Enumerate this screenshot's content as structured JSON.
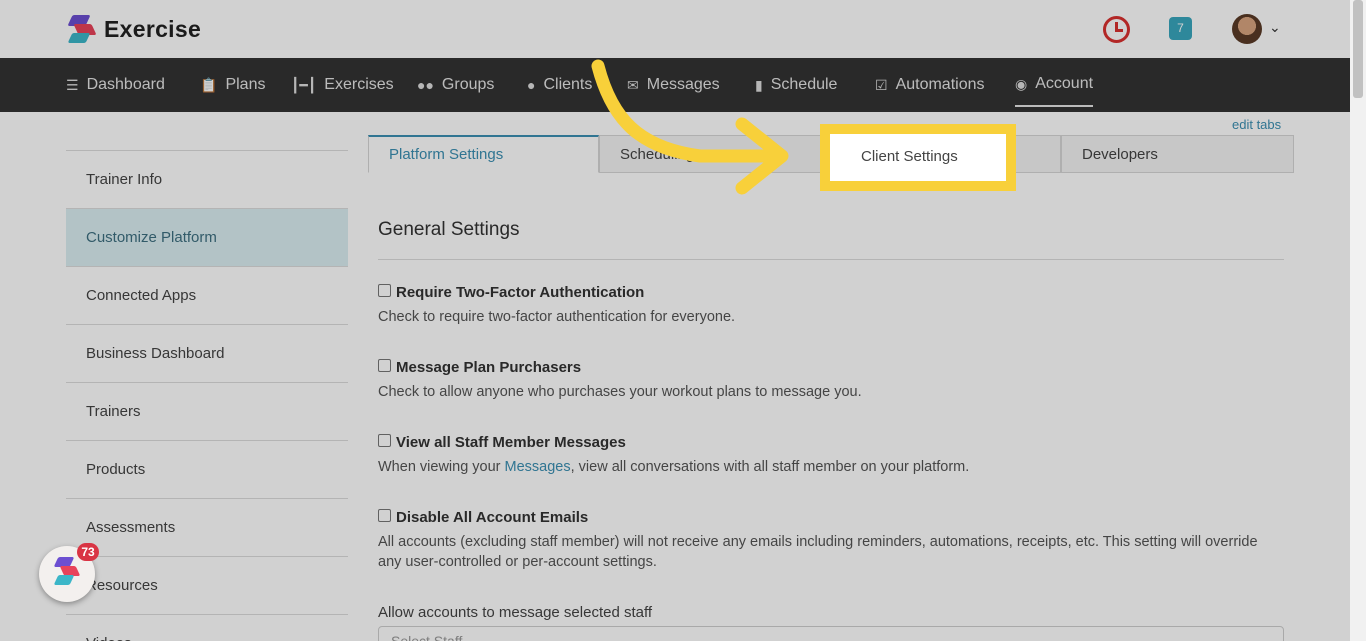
{
  "app": {
    "name": "Exercise"
  },
  "header": {
    "notification_count": "7"
  },
  "nav": {
    "items": [
      {
        "label": "Dashboard",
        "icon": "list-icon"
      },
      {
        "label": "Plans",
        "icon": "clipboard-icon"
      },
      {
        "label": "Exercises",
        "icon": "dumbbell-icon"
      },
      {
        "label": "Groups",
        "icon": "users-icon"
      },
      {
        "label": "Clients",
        "icon": "user-icon"
      },
      {
        "label": "Messages",
        "icon": "envelope-icon"
      },
      {
        "label": "Schedule",
        "icon": "book-icon"
      },
      {
        "label": "Automations",
        "icon": "checkbox-icon"
      },
      {
        "label": "Account",
        "icon": "user-circle-icon"
      }
    ],
    "active": "Account"
  },
  "sidebar": {
    "items": [
      {
        "label": "Trainer Info"
      },
      {
        "label": "Customize Platform"
      },
      {
        "label": "Connected Apps"
      },
      {
        "label": "Business Dashboard"
      },
      {
        "label": "Trainers"
      },
      {
        "label": "Products"
      },
      {
        "label": "Assessments"
      },
      {
        "label": "Resources"
      },
      {
        "label": "Videos"
      }
    ],
    "active": "Customize Platform"
  },
  "tabs": {
    "edit_label": "edit tabs",
    "items": [
      {
        "label": "Platform Settings"
      },
      {
        "label": "Scheduling"
      },
      {
        "label": "Client Settings"
      },
      {
        "label": "Developers"
      }
    ],
    "active": "Platform Settings",
    "highlighted": "Client Settings"
  },
  "content": {
    "section_title": "General Settings",
    "settings": [
      {
        "label": "Require Two-Factor Authentication",
        "checked": false,
        "desc": "Check to require two-factor authentication for everyone."
      },
      {
        "label": "Message Plan Purchasers",
        "checked": false,
        "desc": "Check to allow anyone who purchases your workout plans to message you."
      },
      {
        "label": "View all Staff Member Messages",
        "checked": false,
        "desc_pre": "When viewing your ",
        "desc_link": "Messages",
        "desc_post": ", view all conversations with all staff member on your platform."
      },
      {
        "label": "Disable All Account Emails",
        "checked": false,
        "desc": "All accounts (excluding staff member) will not receive any emails including reminders, automations, receipts, etc. This setting will override any user-controlled or per-account settings."
      }
    ],
    "staff_label": "Allow accounts to message selected staff",
    "staff_placeholder": "Select Staff"
  },
  "widget": {
    "badge_count": "73"
  },
  "colors": {
    "accent": "#3b8fb2",
    "highlight": "#f8d03a",
    "nav_bg": "#333333",
    "alert": "#d9302f"
  }
}
